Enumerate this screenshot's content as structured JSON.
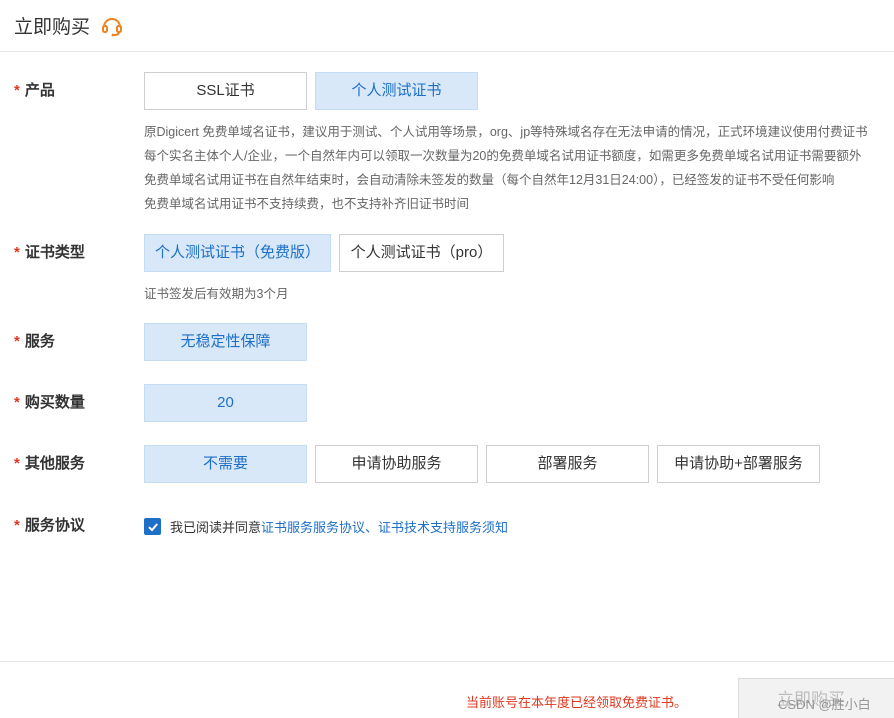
{
  "header": {
    "title": "立即购买"
  },
  "form": {
    "product": {
      "label": "产品",
      "options": [
        "SSL证书",
        "个人测试证书"
      ],
      "selected": "个人测试证书",
      "desc": [
        "原Digicert 免费单域名证书，建议用于测试、个人试用等场景，org、jp等特殊域名存在无法申请的情况，正式环境建议使用付费证书",
        "每个实名主体个人/企业，一个自然年内可以领取一次数量为20的免费单域名试用证书额度，如需更多免费单域名试用证书需要额外",
        "免费单域名试用证书在自然年结束时，会自动清除未签发的数量（每个自然年12月31日24:00），已经签发的证书不受任何影响",
        "免费单域名试用证书不支持续费，也不支持补齐旧证书时间"
      ]
    },
    "cert_type": {
      "label": "证书类型",
      "options": [
        "个人测试证书（免费版）",
        "个人测试证书（pro）"
      ],
      "selected": "个人测试证书（免费版）",
      "desc": "证书签发后有效期为3个月"
    },
    "service": {
      "label": "服务",
      "options": [
        "无稳定性保障"
      ],
      "selected": "无稳定性保障"
    },
    "quantity": {
      "label": "购买数量",
      "value": "20"
    },
    "other_service": {
      "label": "其他服务",
      "options": [
        "不需要",
        "申请协助服务",
        "部署服务",
        "申请协助+部署服务"
      ],
      "selected": "不需要"
    },
    "agreement": {
      "label": "服务协议",
      "checked": true,
      "text": "我已阅读并同意",
      "links": [
        "证书服务服务协议",
        "、",
        "证书技术支持服务须知"
      ]
    }
  },
  "footer": {
    "notice": "当前账号在本年度已经领取免费证书。",
    "buy_label": "立即购买",
    "watermark": "CSDN @胜小白"
  },
  "colors": {
    "accent": "#1d6fc7",
    "selected_bg": "#d8e8f8",
    "required": "#e0371f",
    "icon_orange": "#f0831e"
  }
}
